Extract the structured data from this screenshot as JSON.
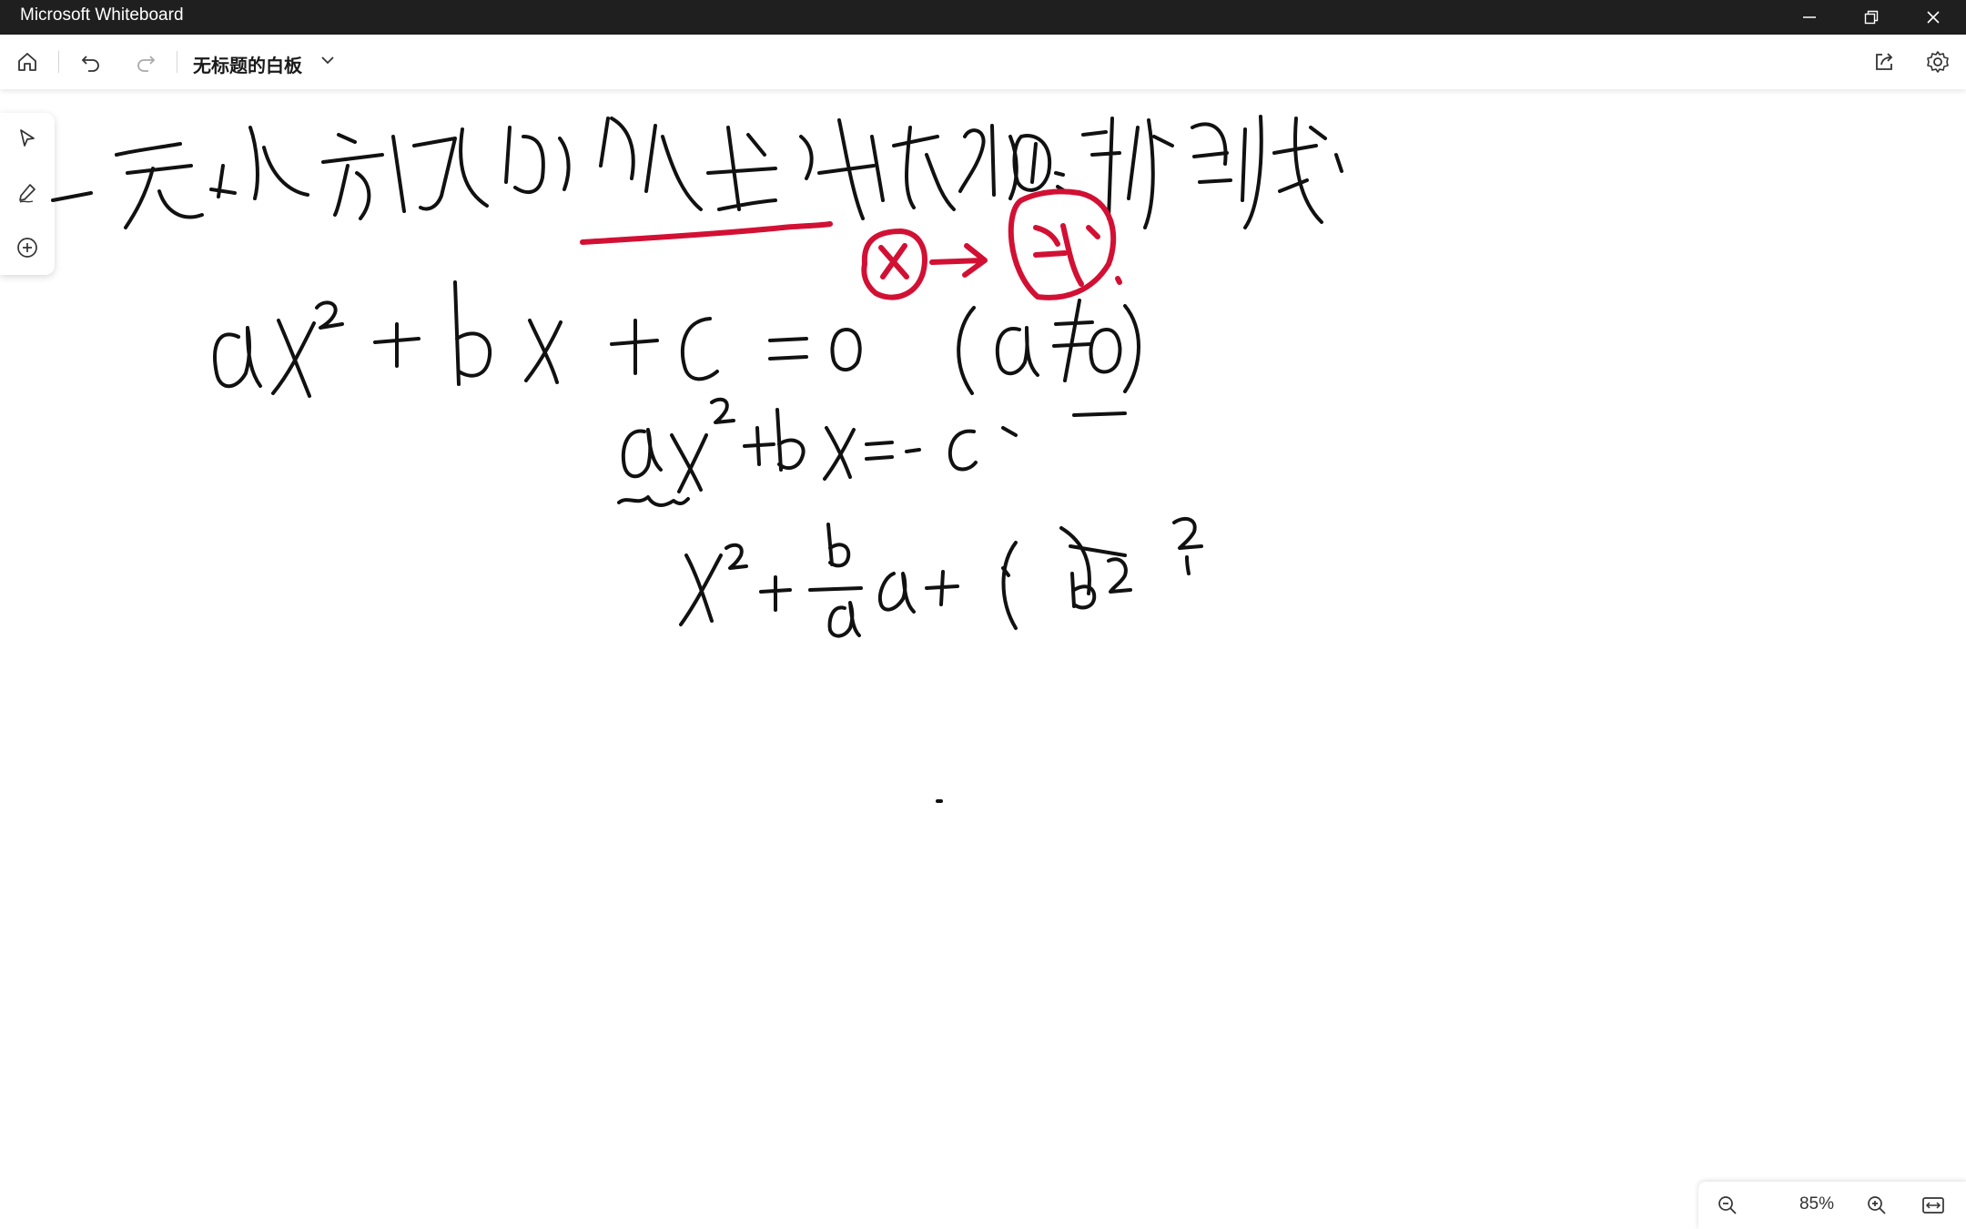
{
  "window": {
    "title": "Microsoft Whiteboard"
  },
  "toolbar": {
    "board_title": "无标题的白板"
  },
  "zoom": {
    "level": "85%"
  },
  "icons": {
    "home": "home-icon",
    "undo": "undo-icon",
    "redo": "redo-icon",
    "dropdown": "chevron-down-icon",
    "share": "share-icon",
    "settings": "gear-icon",
    "select": "pointer-icon",
    "pen": "pen-icon",
    "add": "add-icon",
    "zoom_out": "zoom-out-icon",
    "zoom_in": "zoom-in-icon",
    "fit": "fit-width-icon",
    "minimize": "minimize-icon",
    "restore": "restore-icon",
    "close": "close-icon"
  },
  "colors": {
    "ink": "#111111",
    "accent_ink": "#d21034",
    "titlebar": "#1f1f1f"
  }
}
